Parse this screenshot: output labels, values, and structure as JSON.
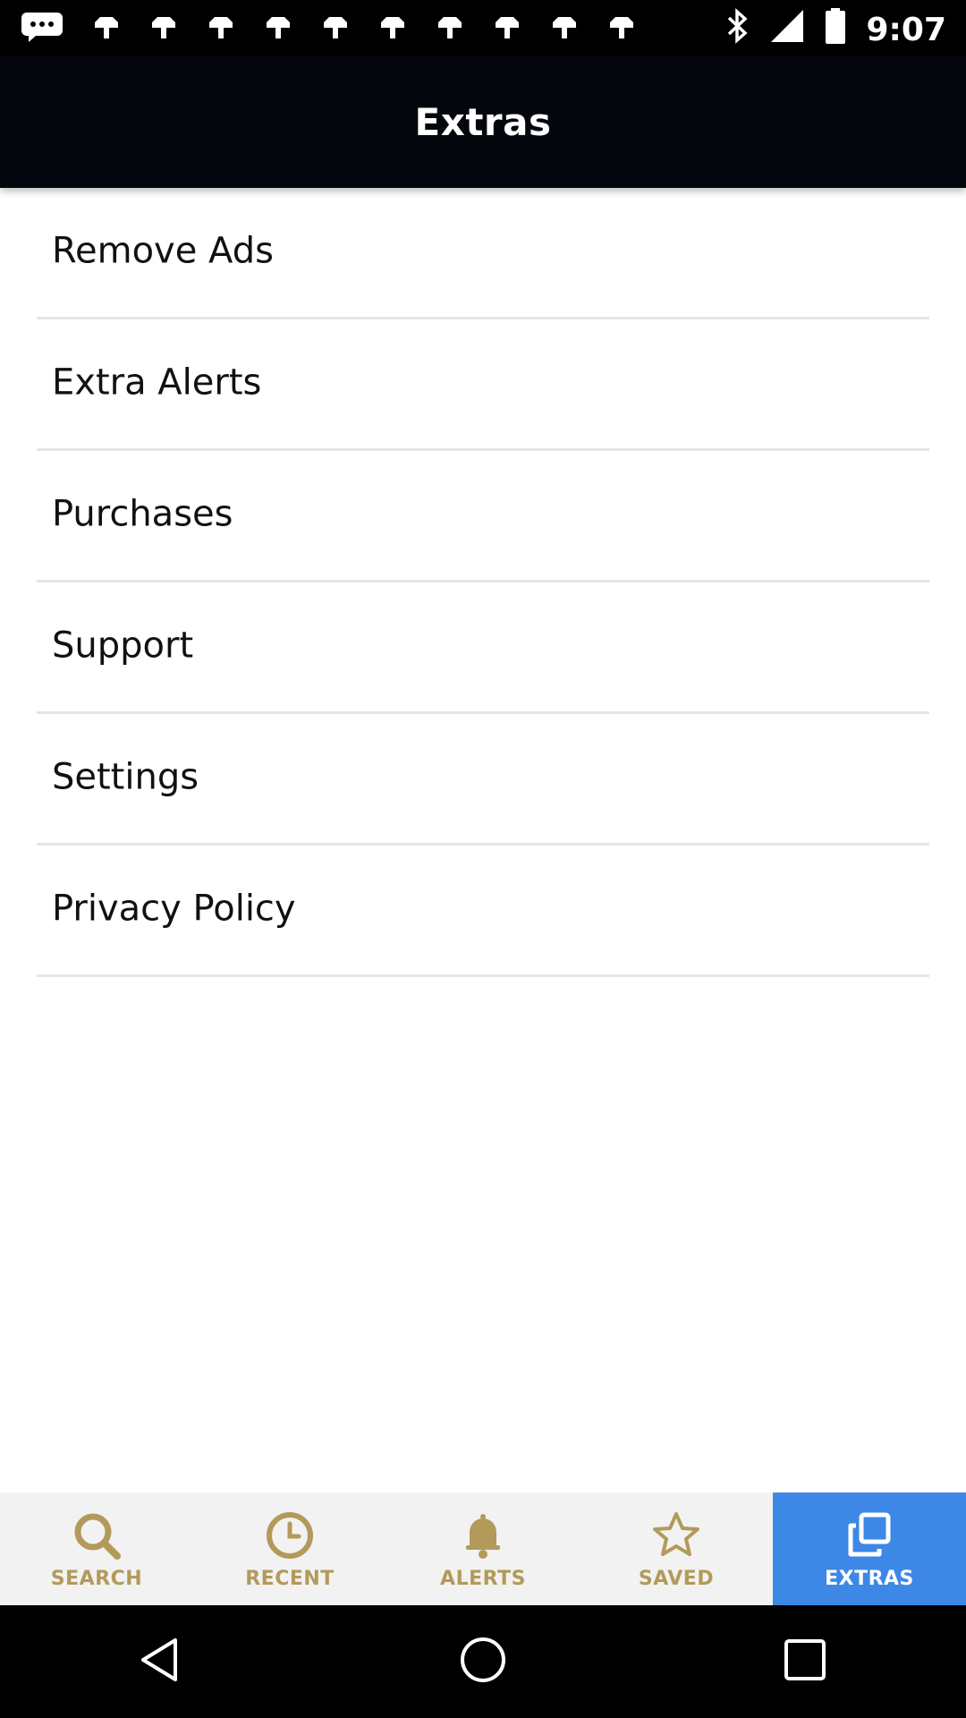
{
  "status_bar": {
    "time": "9:07",
    "notification_icons": [
      "chat-icon",
      "notification-icon",
      "notification-icon",
      "notification-icon",
      "notification-icon",
      "notification-icon",
      "notification-icon",
      "notification-icon",
      "notification-icon",
      "notification-icon",
      "notification-icon"
    ],
    "system_icons": [
      "bluetooth-icon",
      "signal-icon",
      "battery-icon"
    ]
  },
  "app_bar": {
    "title": "Extras"
  },
  "menu": {
    "items": [
      {
        "label": "Remove Ads"
      },
      {
        "label": "Extra Alerts"
      },
      {
        "label": "Purchases"
      },
      {
        "label": "Support"
      },
      {
        "label": "Settings"
      },
      {
        "label": "Privacy Policy"
      }
    ]
  },
  "bottom_nav": {
    "items": [
      {
        "label": "SEARCH",
        "icon": "search-icon"
      },
      {
        "label": "RECENT",
        "icon": "clock-icon"
      },
      {
        "label": "ALERTS",
        "icon": "bell-icon"
      },
      {
        "label": "SAVED",
        "icon": "star-icon"
      },
      {
        "label": "EXTRAS",
        "icon": "copy-icon",
        "active": true
      }
    ],
    "inactive_color": "#b39a5a",
    "active_background": "#3d88e6"
  },
  "system_nav": {
    "buttons": [
      "back-icon",
      "home-icon",
      "recents-icon"
    ]
  }
}
